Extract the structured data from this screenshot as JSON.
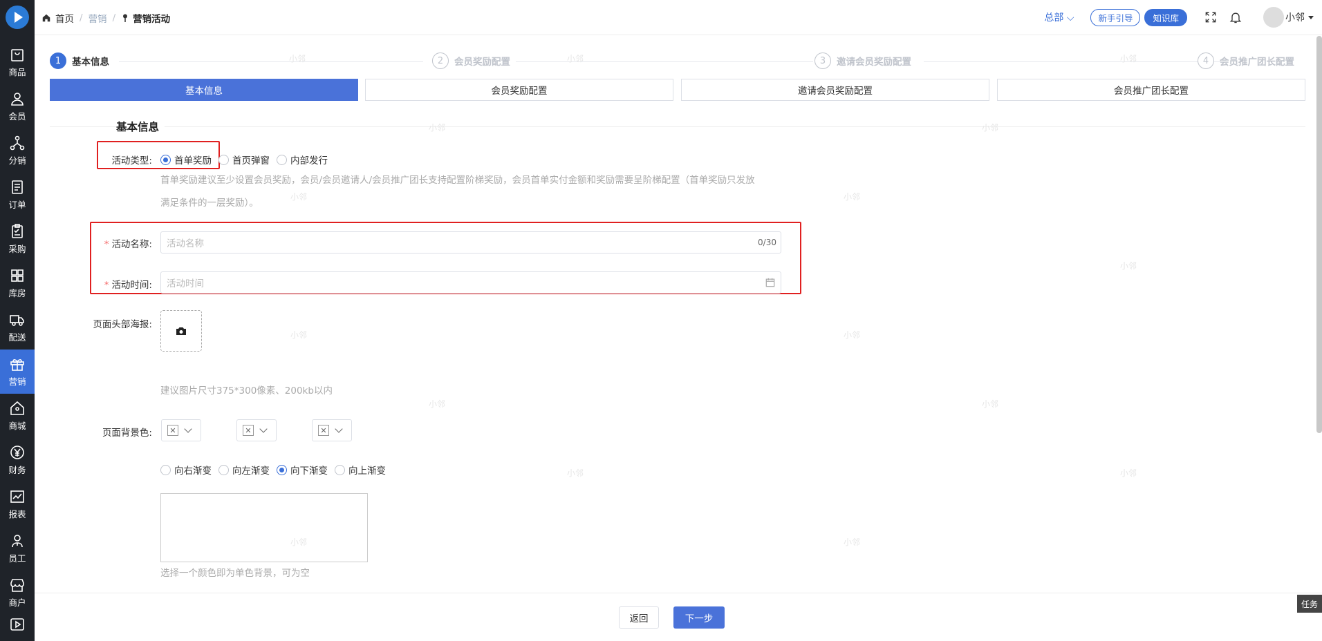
{
  "sidebar": {
    "items": [
      {
        "label": "商品",
        "icon": "bag-icon"
      },
      {
        "label": "会员",
        "icon": "user-icon"
      },
      {
        "label": "分销",
        "icon": "network-icon"
      },
      {
        "label": "订单",
        "icon": "document-icon"
      },
      {
        "label": "采购",
        "icon": "clipboard-icon"
      },
      {
        "label": "库房",
        "icon": "grid-icon"
      },
      {
        "label": "配送",
        "icon": "truck-icon"
      },
      {
        "label": "营销",
        "icon": "gift-icon"
      },
      {
        "label": "商城",
        "icon": "home-icon"
      },
      {
        "label": "财务",
        "icon": "yen-icon"
      },
      {
        "label": "报表",
        "icon": "chart-icon"
      },
      {
        "label": "员工",
        "icon": "staff-icon"
      },
      {
        "label": "商户",
        "icon": "store-icon"
      },
      {
        "label": "",
        "icon": "play-icon"
      }
    ],
    "active_index": 7
  },
  "header": {
    "breadcrumb": {
      "home": "首页",
      "parent": "营销",
      "current": "营销活动"
    },
    "org": "总部",
    "guide_button": "新手引导",
    "kb_button": "知识库",
    "username": "小邻"
  },
  "steps": [
    {
      "num": "1",
      "label": "基本信息"
    },
    {
      "num": "2",
      "label": "会员奖励配置"
    },
    {
      "num": "3",
      "label": "邀请会员奖励配置"
    },
    {
      "num": "4",
      "label": "会员推广团长配置"
    }
  ],
  "tabs": [
    "基本信息",
    "会员奖励配置",
    "邀请会员奖励配置",
    "会员推广团长配置"
  ],
  "form": {
    "section_title": "基本信息",
    "type_label": "活动类型:",
    "type_options": [
      "首单奖励",
      "首页弹窗",
      "内部发行"
    ],
    "type_hint_1": "首单奖励建议至少设置会员奖励，会员/会员邀请人/会员推广团长支持配置阶梯奖励，会员首单实付金额和奖励需要呈阶梯配置（首单奖励只发放",
    "type_hint_2": "满足条件的一层奖励）。",
    "name_label": "活动名称:",
    "name_placeholder": "活动名称",
    "name_counter": "0/30",
    "time_label": "活动时间:",
    "time_placeholder": "活动时间",
    "poster_label": "页面头部海报:",
    "poster_hint": "建议图片尺寸375*300像素、200kb以内",
    "bg_label": "页面背景色:",
    "gradient_options": [
      "向右渐变",
      "向左渐变",
      "向下渐变",
      "向上渐变"
    ],
    "bg_hint": "选择一个颜色即为单色背景，可为空"
  },
  "footer": {
    "back": "返回",
    "next": "下一步"
  },
  "task_button": "任务",
  "watermark": "小邻",
  "colors": {
    "primary": "#3a6fd8",
    "sidebar": "#1f2329",
    "highlight": "#e02020"
  }
}
